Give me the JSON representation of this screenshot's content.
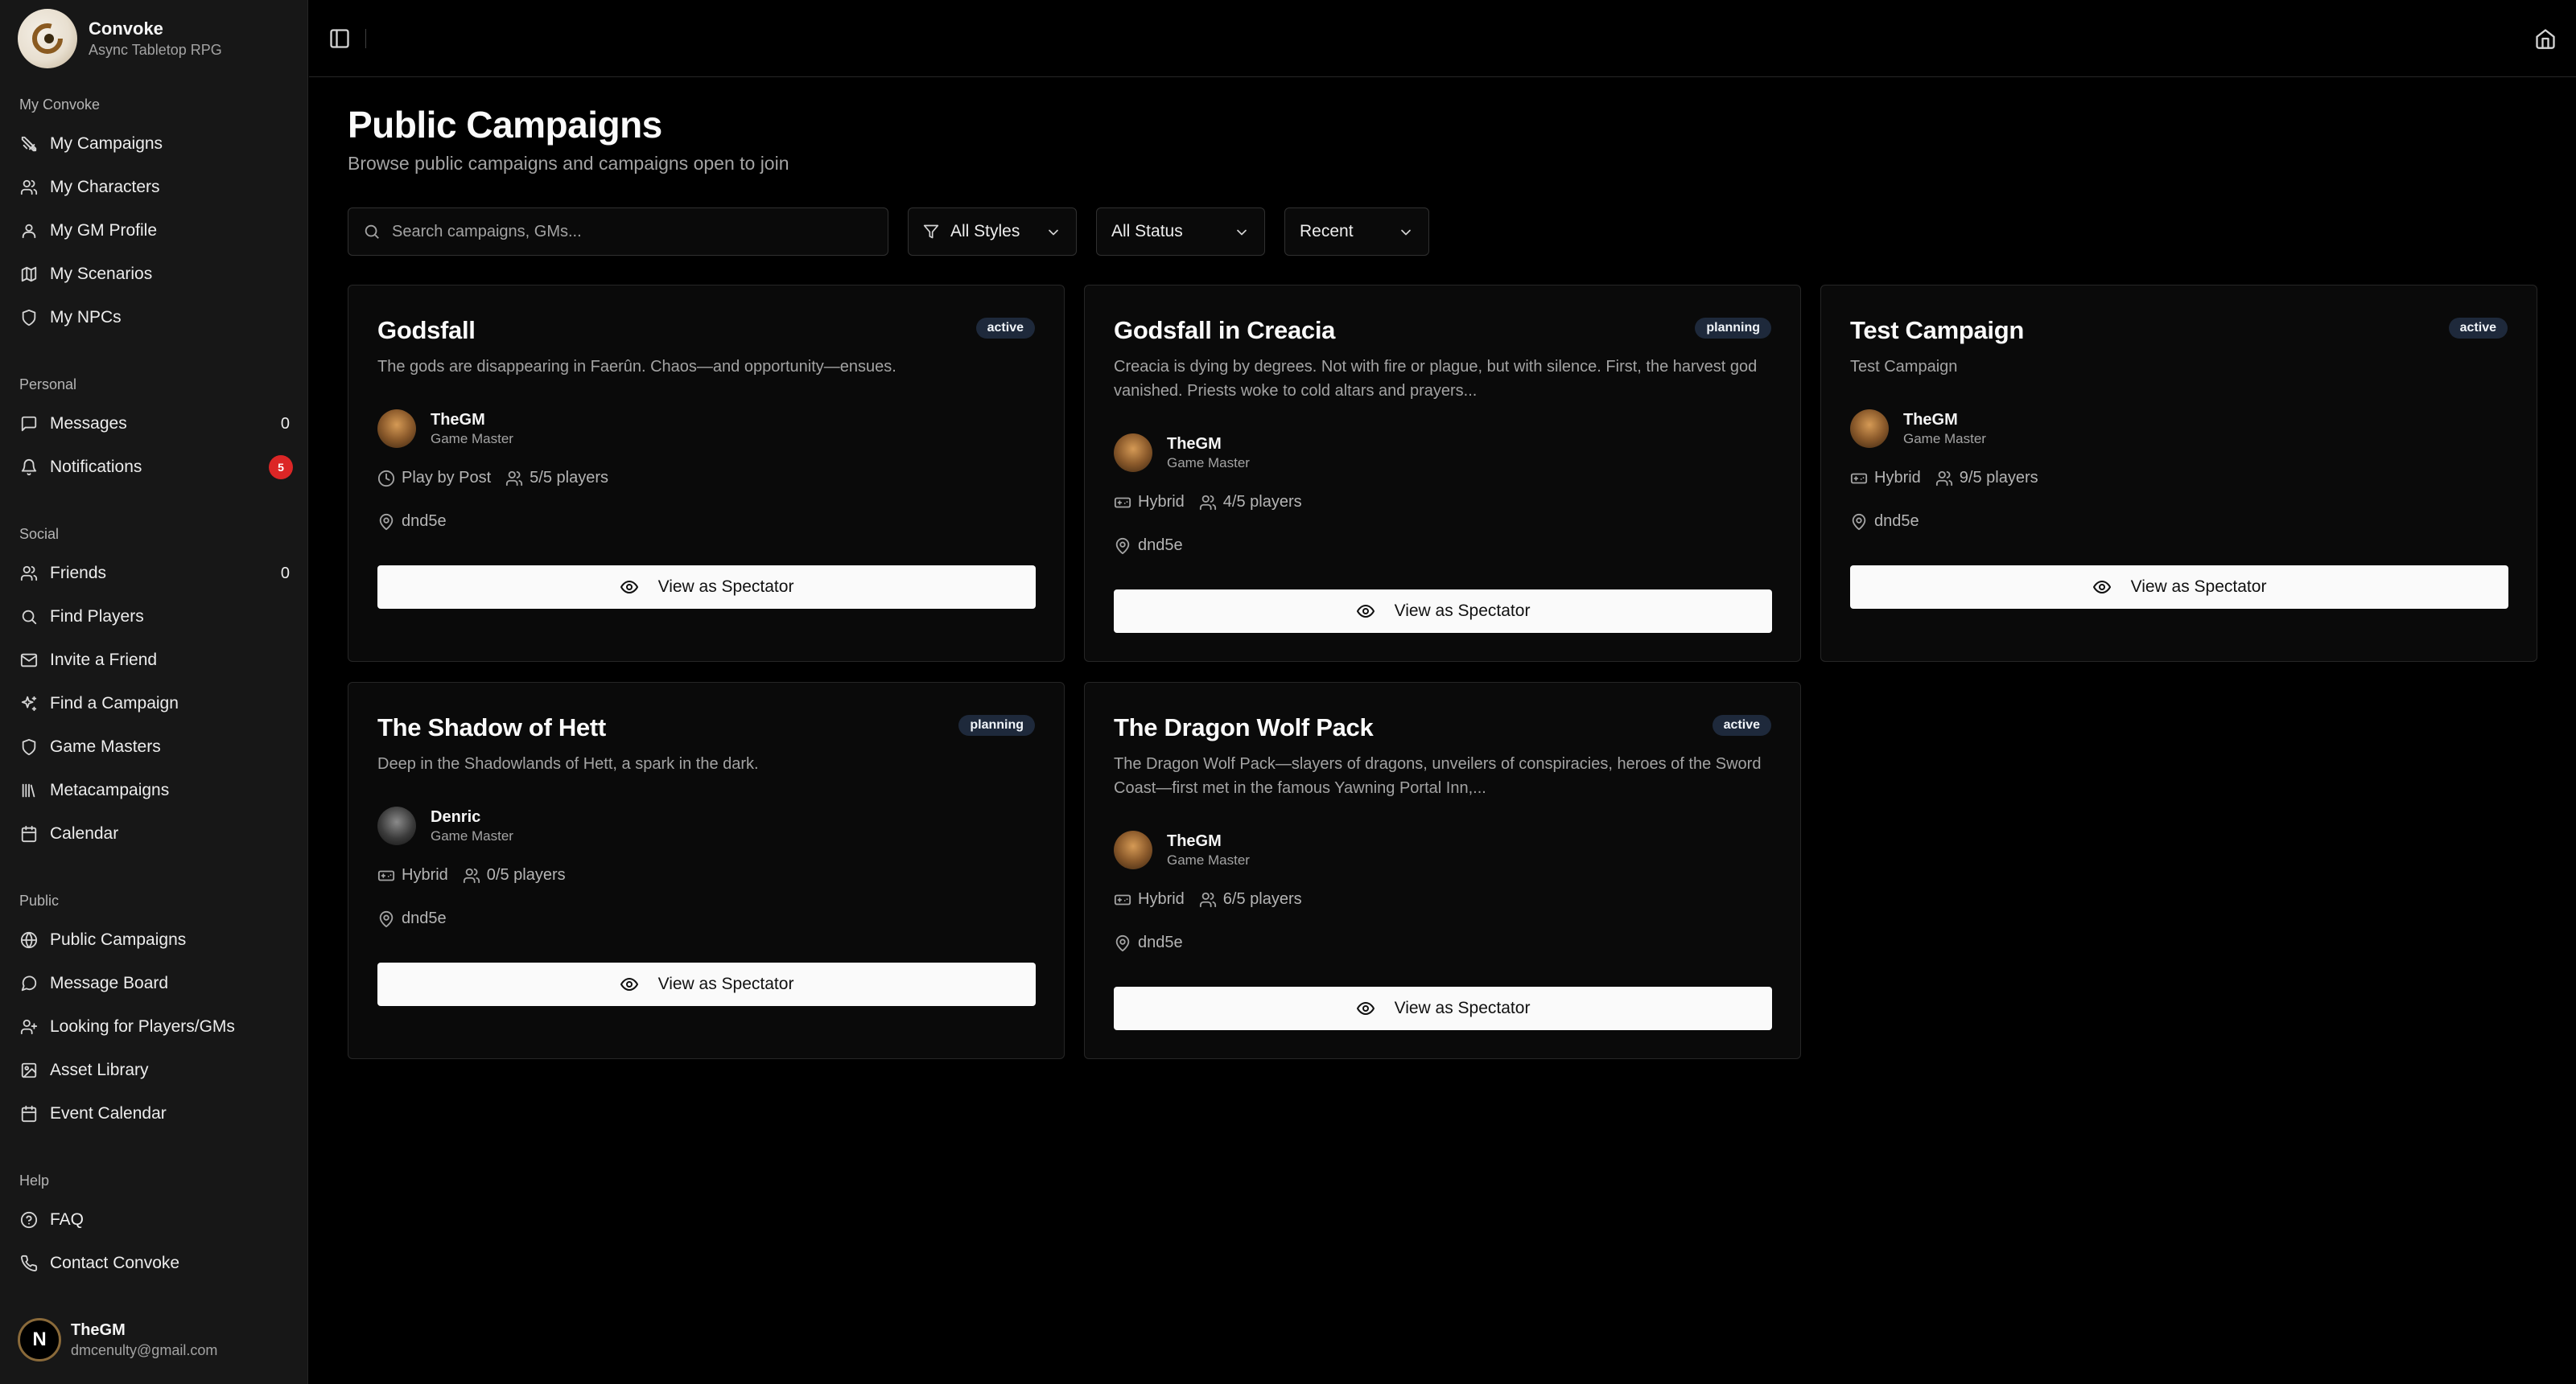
{
  "brand": {
    "title": "Convoke",
    "subtitle": "Async Tabletop RPG"
  },
  "sidebar": {
    "groups": [
      {
        "label": "My Convoke",
        "items": [
          {
            "label": "My Campaigns",
            "icon": "swords-icon"
          },
          {
            "label": "My Characters",
            "icon": "users-icon"
          },
          {
            "label": "My GM Profile",
            "icon": "user-icon"
          },
          {
            "label": "My Scenarios",
            "icon": "map-icon"
          },
          {
            "label": "My NPCs",
            "icon": "shield-icon"
          }
        ]
      },
      {
        "label": "Personal",
        "items": [
          {
            "label": "Messages",
            "icon": "message-icon",
            "count": "0"
          },
          {
            "label": "Notifications",
            "icon": "bell-icon",
            "badge": "5"
          }
        ]
      },
      {
        "label": "Social",
        "items": [
          {
            "label": "Friends",
            "icon": "users-icon",
            "count": "0"
          },
          {
            "label": "Find Players",
            "icon": "search-icon"
          },
          {
            "label": "Invite a Friend",
            "icon": "mail-icon"
          },
          {
            "label": "Find a Campaign",
            "icon": "sparkles-icon"
          },
          {
            "label": "Game Masters",
            "icon": "shield-icon"
          },
          {
            "label": "Metacampaigns",
            "icon": "library-icon"
          },
          {
            "label": "Calendar",
            "icon": "calendar-icon"
          }
        ]
      },
      {
        "label": "Public",
        "items": [
          {
            "label": "Public Campaigns",
            "icon": "globe-icon"
          },
          {
            "label": "Message Board",
            "icon": "message-icon"
          },
          {
            "label": "Looking for Players/GMs",
            "icon": "user-plus-icon"
          },
          {
            "label": "Asset Library",
            "icon": "image-icon"
          },
          {
            "label": "Event Calendar",
            "icon": "calendar-icon"
          }
        ]
      },
      {
        "label": "Help",
        "items": [
          {
            "label": "FAQ",
            "icon": "help-icon"
          },
          {
            "label": "Contact Convoke",
            "icon": "phone-icon"
          }
        ]
      }
    ]
  },
  "user": {
    "initial": "N",
    "name": "TheGM",
    "email": "dmcenulty@gmail.com"
  },
  "main": {
    "title": "Public Campaigns",
    "subtitle": "Browse public campaigns and campaigns open to join",
    "search_placeholder": "Search campaigns, GMs...",
    "filters": {
      "style": "All Styles",
      "status": "All Status",
      "sort": "Recent"
    }
  },
  "campaigns": [
    {
      "title": "Godsfall",
      "status": "active",
      "desc": "The gods are disappearing in Faerûn. Chaos—and opportunity—ensues.",
      "gm": "TheGM",
      "gm_role": "Game Master",
      "mode": "Play by Post",
      "players": "5/5 players",
      "system": "dnd5e",
      "action": "View as Spectator"
    },
    {
      "title": "Godsfall in Creacia",
      "status": "planning",
      "desc": "Creacia is dying by degrees. Not with fire or plague, but with silence. First, the harvest god vanished. Priests woke to cold altars and prayers...",
      "gm": "TheGM",
      "gm_role": "Game Master",
      "mode": "Hybrid",
      "players": "4/5 players",
      "system": "dnd5e",
      "action": "View as Spectator"
    },
    {
      "title": "Test Campaign",
      "status": "active",
      "desc": "Test Campaign",
      "gm": "TheGM",
      "gm_role": "Game Master",
      "mode": "Hybrid",
      "players": "9/5 players",
      "system": "dnd5e",
      "action": "View as Spectator"
    },
    {
      "title": "The Shadow of Hett",
      "status": "planning",
      "desc": "Deep in the Shadowlands of Hett, a spark in the dark.",
      "gm": "Denric",
      "gm_role": "Game Master",
      "mode": "Hybrid",
      "players": "0/5 players",
      "system": "dnd5e",
      "action": "View as Spectator"
    },
    {
      "title": "The Dragon Wolf Pack",
      "status": "active",
      "desc": "The Dragon Wolf Pack—slayers of dragons, unveilers of conspiracies, heroes of the Sword Coast—first met in the famous Yawning Portal Inn,...",
      "gm": "TheGM",
      "gm_role": "Game Master",
      "mode": "Hybrid",
      "players": "6/5 players",
      "system": "dnd5e",
      "action": "View as Spectator"
    }
  ]
}
